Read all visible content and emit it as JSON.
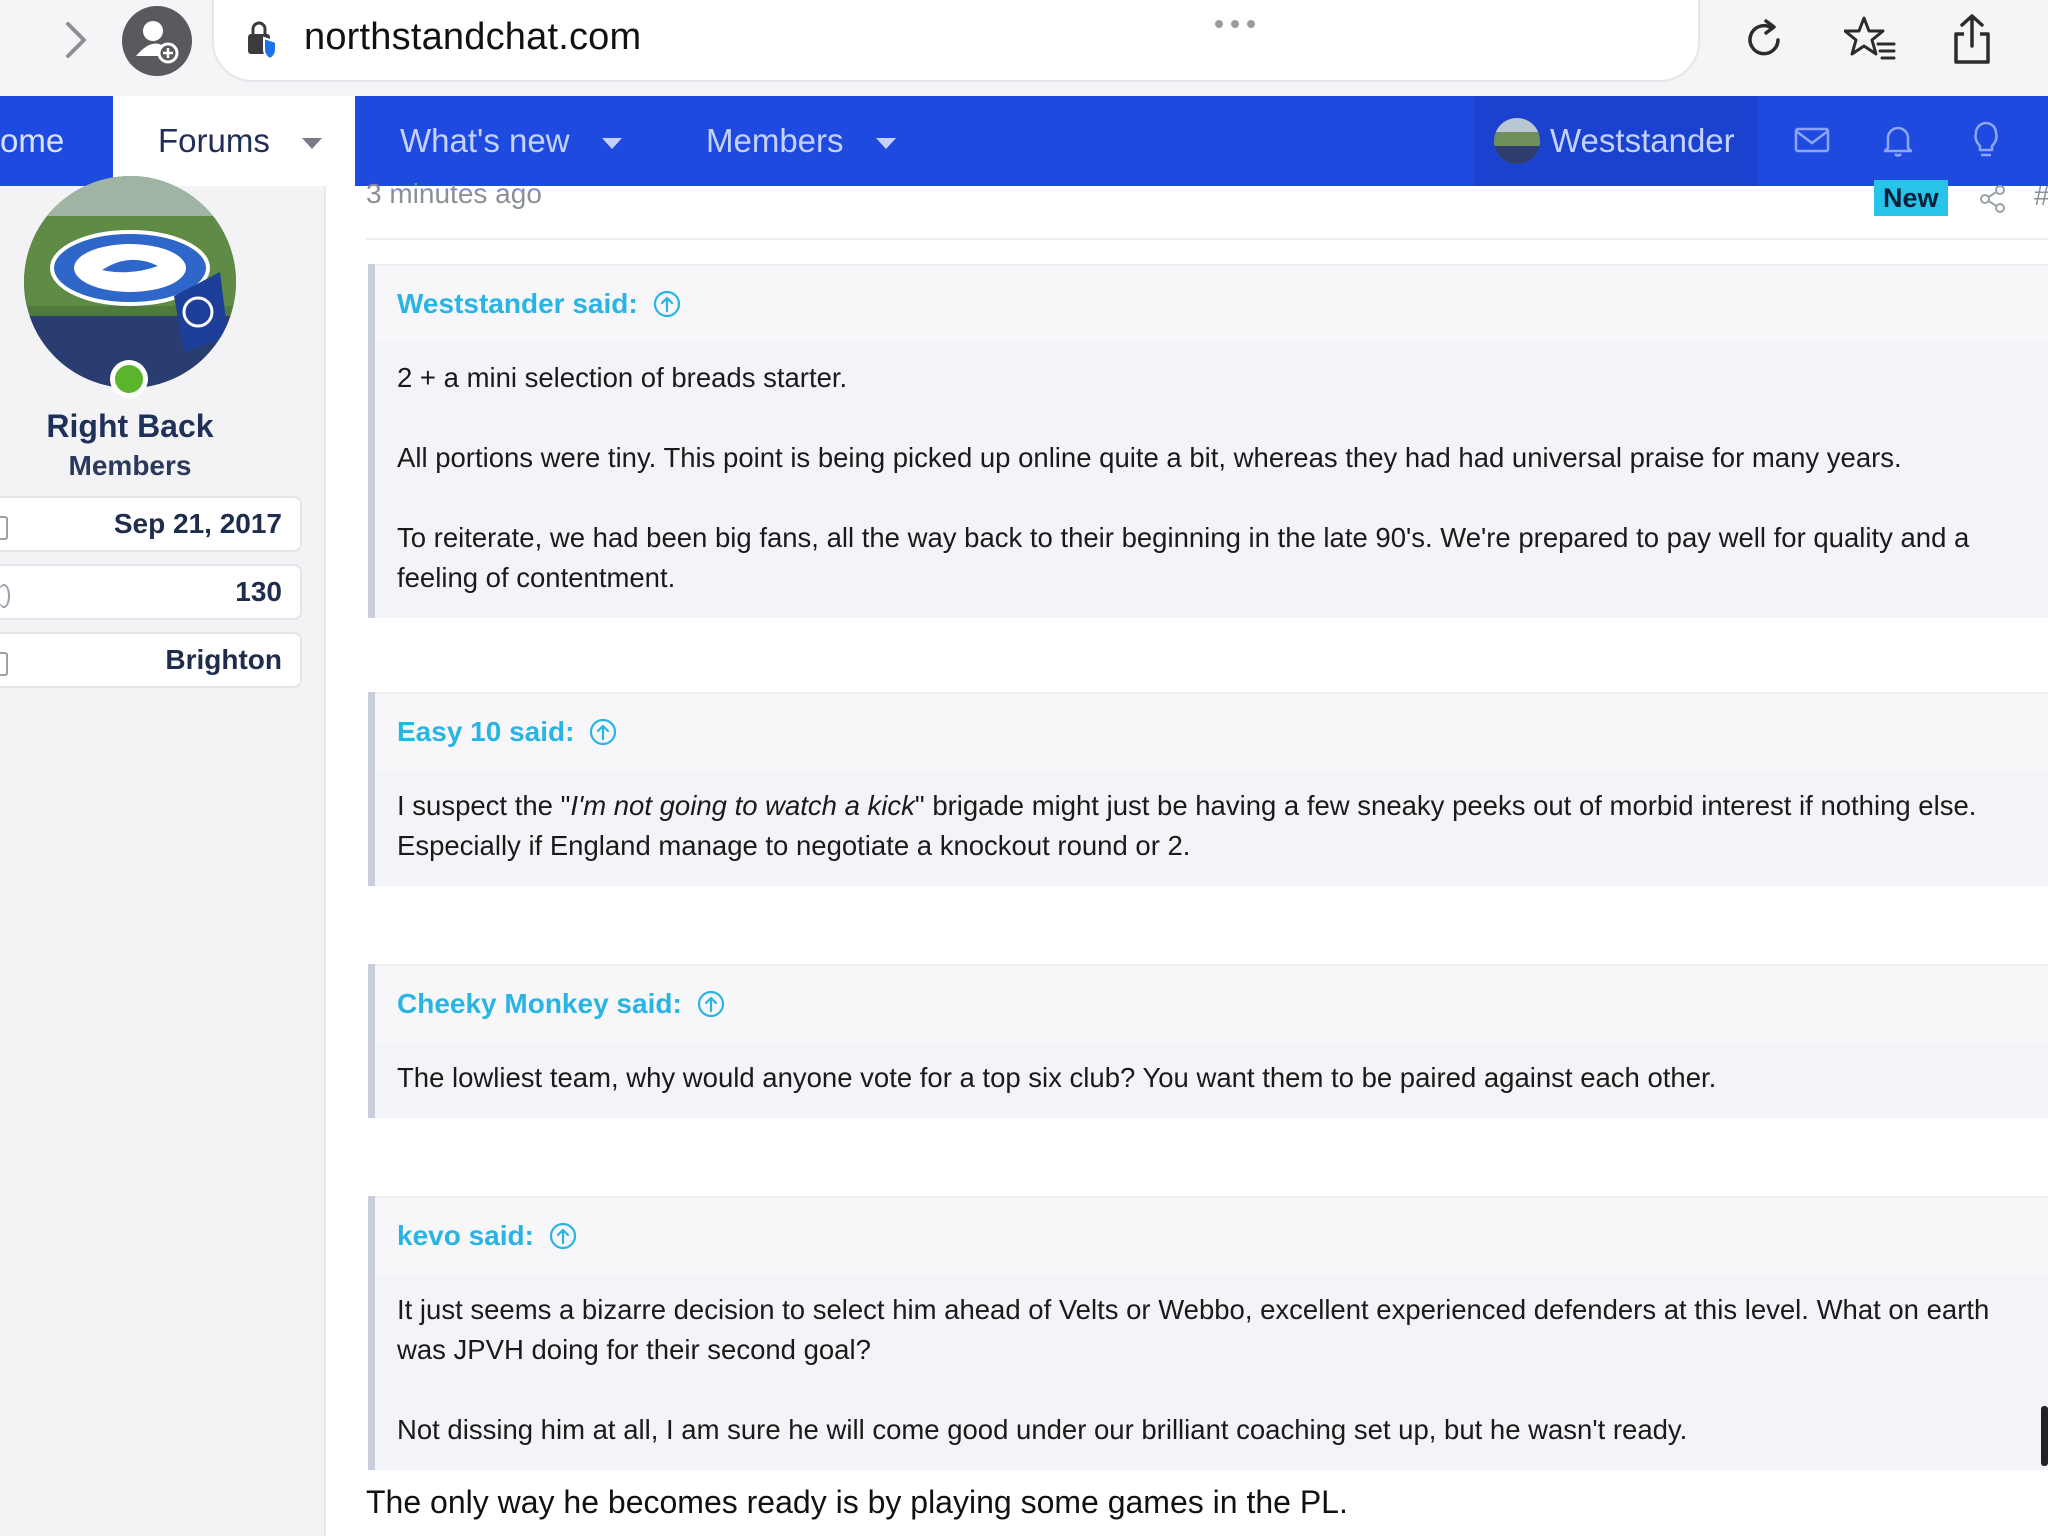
{
  "browser": {
    "url": "northstandchat.com"
  },
  "nav": {
    "home_label": "ome",
    "forums_label": "Forums",
    "whatsnew_label": "What's new",
    "members_label": "Members",
    "username": "Weststander"
  },
  "poster": {
    "name": "Right Back",
    "role": "Members",
    "stats": [
      {
        "icon": "calendar-icon",
        "value": "Sep 21, 2017"
      },
      {
        "icon": "messages-icon",
        "value": "130"
      },
      {
        "icon": "location-icon",
        "value": "Brighton"
      }
    ]
  },
  "post": {
    "time": "3 minutes ago",
    "new_badge": "New",
    "hash": "#",
    "quotes": [
      {
        "author": "Weststander said:",
        "lines": [
          "2 + a mini selection of breads starter.",
          "",
          "All portions were tiny. This point is being picked up online quite a bit, whereas they had had universal praise for many years.",
          "",
          "To reiterate, we had been big fans, all the way back to their beginning in the late 90's. We're prepared to pay well for quality and a",
          "feeling of contentment."
        ]
      },
      {
        "author": "Easy 10 said:",
        "line1_pre": "I suspect the \"",
        "line1_em": "I'm not going to watch a kick",
        "line1_post": "\" brigade might just be having a few sneaky peeks out of morbid interest if nothing else.",
        "line2": "Especially if England manage to negotiate a knockout round or 2."
      },
      {
        "author": "Cheeky Monkey said:",
        "lines": [
          "The lowliest team, why would anyone vote for a top six club? You want them to be paired against each other."
        ]
      },
      {
        "author": "kevo said:",
        "lines": [
          "It just seems a bizarre decision to select him ahead of Velts or Webbo, excellent experienced defenders at this level. What on earth",
          "was JPVH doing for their second goal?",
          "",
          "Not dissing him at all, I am sure he will come good under our brilliant coaching set up, but he wasn't ready."
        ]
      }
    ],
    "reply": "The only way he becomes ready is by playing some games in the PL."
  },
  "colors": {
    "nav_blue": "#1e4ae0",
    "quote_author": "#2ab4e4",
    "new_badge": "#27c3e8",
    "online": "#5ab52c"
  }
}
